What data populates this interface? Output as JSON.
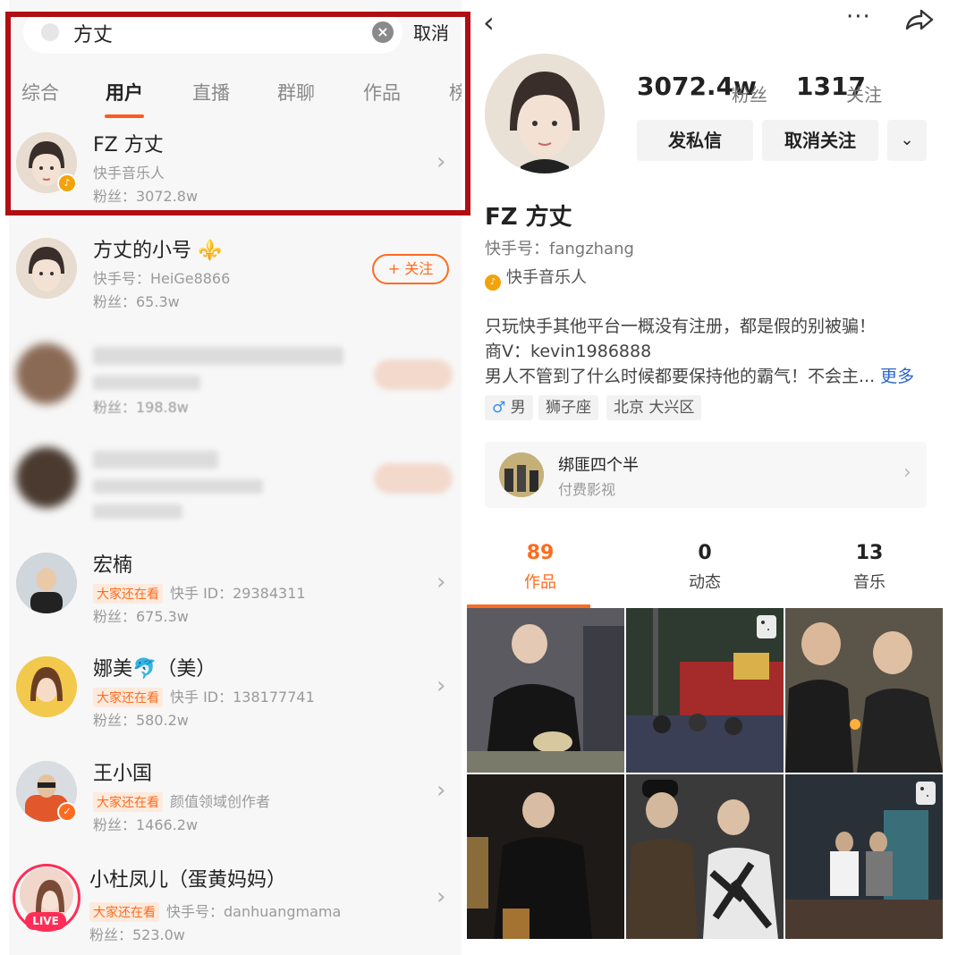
{
  "left": {
    "search": {
      "query": "方丈",
      "cancel": "取消"
    },
    "tabs": [
      "综合",
      "用户",
      "直播",
      "群聊",
      "作品",
      "榜"
    ],
    "top_result": {
      "name": "FZ 方丈",
      "role": "快手音乐人",
      "fans": "粉丝：3072.8w"
    },
    "results": [
      {
        "name": "方丈的小号 ⚜️",
        "id": "快手号：HeiGe8866",
        "fans": "粉丝：65.3w",
        "follow": "+ 关注"
      },
      {
        "name": "",
        "id": "",
        "fans": "粉丝：198.8w"
      },
      {
        "name": "",
        "id": "",
        "fans": ""
      },
      {
        "name": "宏楠",
        "tag": "大家还在看",
        "id": "快手 ID：29384311",
        "fans": "粉丝：675.3w"
      },
      {
        "name": "娜美🐬（美）",
        "tag": "大家还在看",
        "id": "快手 ID：138177741",
        "fans": "粉丝：580.2w"
      },
      {
        "name": "王小国",
        "tag": "大家还在看",
        "id": "颜值领域创作者",
        "fans": "粉丝：1466.2w"
      },
      {
        "name": "小杜凤儿（蛋黄妈妈）",
        "tag": "大家还在看",
        "id": "快手号：danhuangmama",
        "fans": "粉丝：523.0w",
        "live": "LIVE"
      }
    ]
  },
  "right": {
    "fans_count": "3072.4w",
    "fans_label": "粉丝",
    "following_count": "1317",
    "following_label": "关注",
    "message_button": "发私信",
    "unfollow_button": "取消关注",
    "name": "FZ 方丈",
    "kuaishou_id": "快手号：fangzhang",
    "role": "快手音乐人",
    "bio": [
      "只玩快手其他平台一概没有注册，都是假的别被骗！",
      "商V：kevin1986888",
      "男人不管到了什么时候都要保持他的霸气！不会主..."
    ],
    "bio_more": "更多",
    "chips": {
      "gender_symbol": "♂",
      "gender": "男",
      "zodiac": "狮子座",
      "location": "北京 大兴区"
    },
    "movie": {
      "title": "绑匪四个半",
      "subtitle": "付费影视"
    },
    "profile_tabs": [
      {
        "num": "89",
        "label": "作品"
      },
      {
        "num": "0",
        "label": "动态"
      },
      {
        "num": "13",
        "label": "音乐"
      }
    ]
  },
  "colors": {
    "accent": "#ff6b1f",
    "highlight_border": "#b00e14",
    "link": "#2a67c7"
  },
  "icons": [
    "search-icon",
    "clear-icon",
    "chevron-right-icon",
    "back-icon",
    "more-icon",
    "share-icon",
    "chevron-down-icon",
    "verified-icon",
    "music-note-icon",
    "male-icon",
    "live-icon"
  ]
}
